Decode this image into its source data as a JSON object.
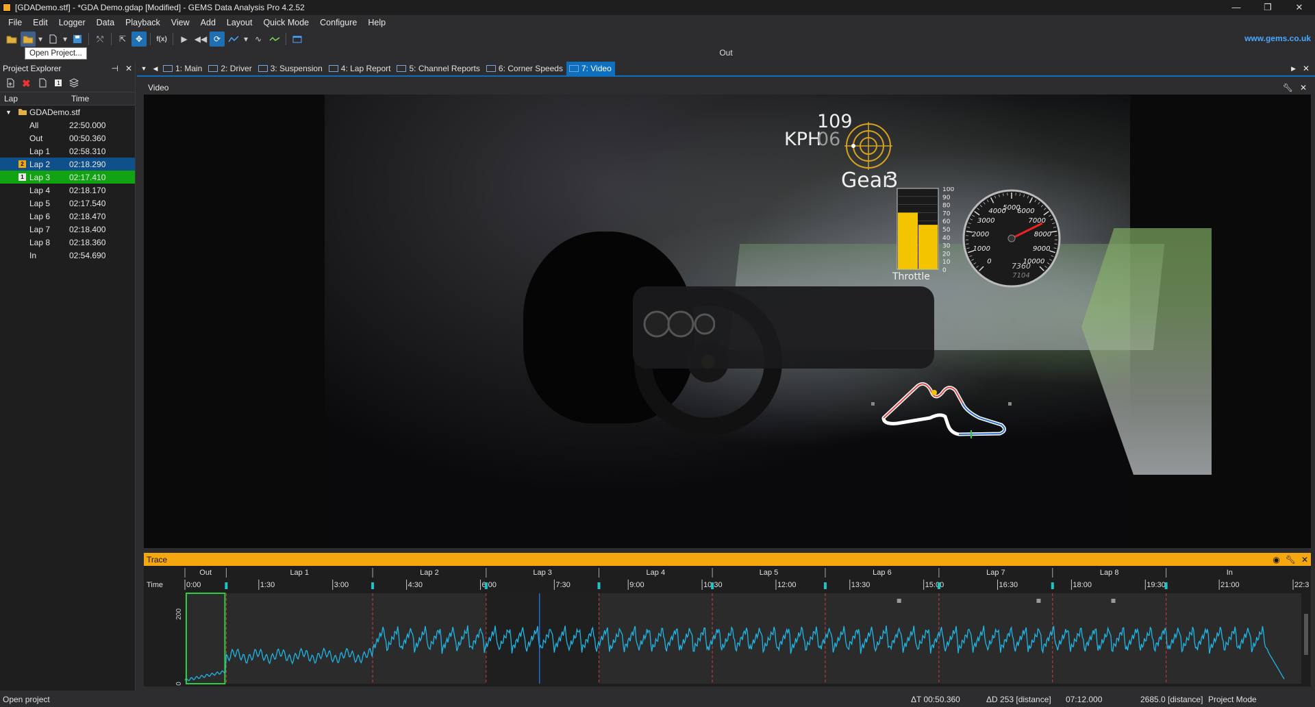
{
  "window": {
    "title": "[GDADemo.stf] - *GDA Demo.gdap [Modified] - GEMS Data Analysis Pro 4.2.52",
    "minimize": "—",
    "maximize": "❐",
    "close": "✕"
  },
  "menu": [
    "File",
    "Edit",
    "Logger",
    "Data",
    "Playback",
    "View",
    "Add",
    "Layout",
    "Quick Mode",
    "Configure",
    "Help"
  ],
  "toolbar": {
    "tooltip": "Open Project...",
    "link": "www.gems.co.uk",
    "fx_label": "f(x)"
  },
  "out_label": "Out",
  "project_explorer": {
    "title": "Project Explorer",
    "columns": [
      "Lap",
      "Time"
    ],
    "root": "GDADemo.stf",
    "rows": [
      {
        "lap": "All",
        "time": "22:50.000"
      },
      {
        "lap": "Out",
        "time": "00:50.360"
      },
      {
        "lap": "Lap 1",
        "time": "02:58.310"
      },
      {
        "lap": "Lap 2",
        "time": "02:18.290",
        "marker": "2"
      },
      {
        "lap": "Lap 3",
        "time": "02:17.410",
        "marker": "1"
      },
      {
        "lap": "Lap 4",
        "time": "02:18.170"
      },
      {
        "lap": "Lap 5",
        "time": "02:17.540"
      },
      {
        "lap": "Lap 6",
        "time": "02:18.470"
      },
      {
        "lap": "Lap 7",
        "time": "02:18.400"
      },
      {
        "lap": "Lap 8",
        "time": "02:18.360"
      },
      {
        "lap": "In",
        "time": "02:54.690"
      }
    ]
  },
  "tabs": [
    {
      "label": "1: Main"
    },
    {
      "label": "2: Driver"
    },
    {
      "label": "3: Suspension"
    },
    {
      "label": "4: Lap Report"
    },
    {
      "label": "5: Channel Reports"
    },
    {
      "label": "6: Corner Speeds"
    },
    {
      "label": "7: Video",
      "active": true
    }
  ],
  "video": {
    "title": "Video",
    "speed": "109",
    "speed_unit": "KPH",
    "speed_sub": "06",
    "gear_label": "Gear",
    "gear_value": "3",
    "throttle_label": "Throttle",
    "throttle_level": 0.7,
    "throttle_level_2": 0.55,
    "throttle_scale": [
      "100",
      "90",
      "80",
      "70",
      "60",
      "50",
      "40",
      "30",
      "20",
      "10",
      "0"
    ],
    "rpm_ticks": [
      "0",
      "1000",
      "2000",
      "3000",
      "4000",
      "5000",
      "6000",
      "7000",
      "8000",
      "9000",
      "10000"
    ],
    "rpm_value": "7360",
    "rpm_sub": "7104",
    "rpm_needle": 7360
  },
  "trace": {
    "title": "Trace",
    "laps": [
      "Out",
      "Lap 1",
      "Lap 2",
      "Lap 3",
      "Lap 4",
      "Lap 5",
      "Lap 6",
      "Lap 7",
      "Lap 8",
      "In"
    ],
    "time_label": "Time",
    "time_ticks": [
      "0:00",
      "1:30",
      "3:00",
      "4:30",
      "6:00",
      "7:30",
      "9:00",
      "10:30",
      "12:00",
      "13:30",
      "15:00",
      "16:30",
      "18:00",
      "19:30",
      "21:00",
      "22:3"
    ],
    "y_ticks": [
      "200",
      "0"
    ]
  },
  "status": {
    "left": "Open project",
    "dt": "ΔT 00:50.360",
    "dd": "ΔD 253 [distance]",
    "time": "07:12.000",
    "dist": "2685.0 [distance]",
    "mode": "Project Mode"
  },
  "colors": {
    "accent": "#0e6fbf",
    "trace_header": "#f5a70f",
    "trace_line": "#1fb6e6",
    "throttle": "#f5c400",
    "lap_selected_blue": "#0f4f8a",
    "lap_selected_green": "#11a311"
  }
}
